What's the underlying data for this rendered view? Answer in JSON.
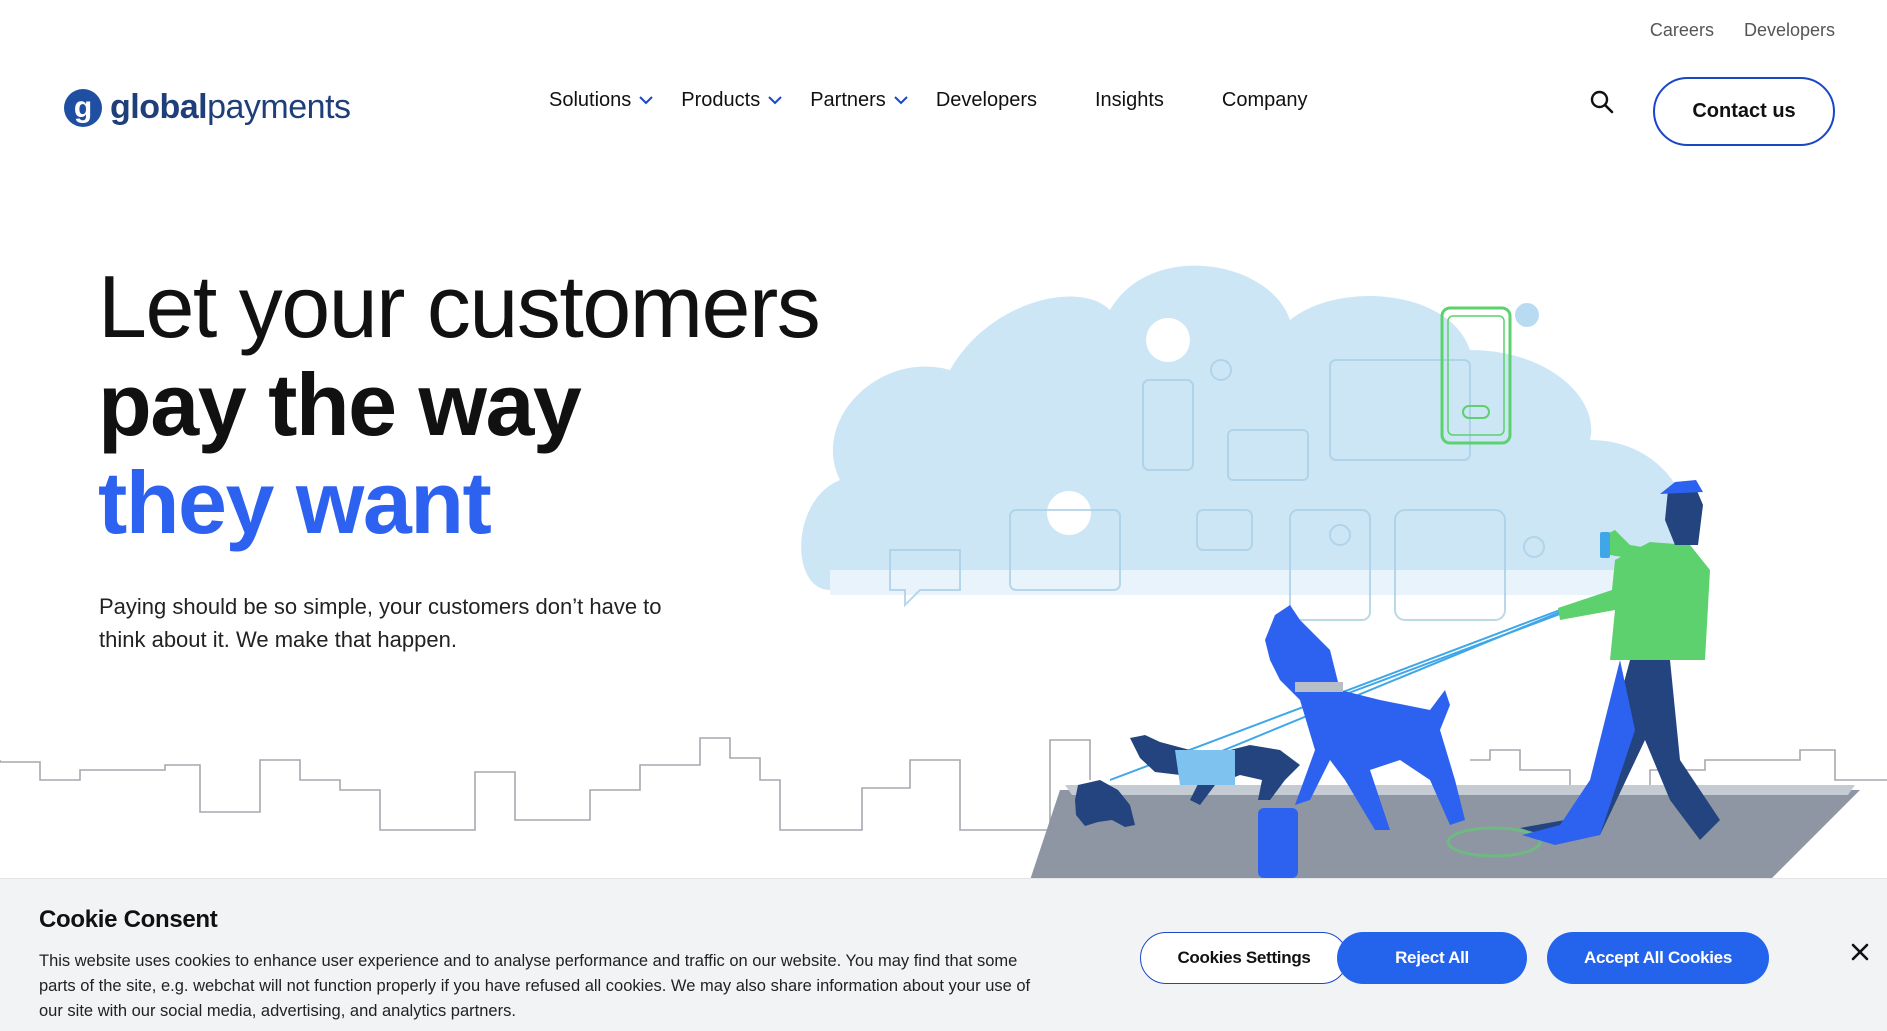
{
  "header": {
    "utility_links": [
      "Careers",
      "Developers"
    ],
    "logo": {
      "mark": "g",
      "text_bold": "global",
      "text_regular": "payments"
    },
    "nav": [
      {
        "label": "Solutions",
        "has_dropdown": true
      },
      {
        "label": "Products",
        "has_dropdown": true
      },
      {
        "label": "Partners",
        "has_dropdown": true
      },
      {
        "label": "Developers",
        "has_dropdown": false
      },
      {
        "label": "Insights",
        "has_dropdown": false
      },
      {
        "label": "Company",
        "has_dropdown": false
      }
    ],
    "search_icon": "search-icon",
    "contact_label": "Contact us"
  },
  "hero": {
    "line1": "Let your customers",
    "line2": "pay the way",
    "line3": "they want",
    "subtitle": "Paying should be so simple, your customers don’t have to think about it. We make that happen."
  },
  "cookie_banner": {
    "title": "Cookie Consent",
    "text": "This website uses cookies to enhance user experience and to analyse performance and traffic on our website. You may find that some parts of the site, e.g. webchat will not function properly if you have refused all cookies. We may also share information about your use of our site with our social media, advertising, and analytics partners.",
    "settings_label": "Cookies Settings",
    "reject_label": "Reject All",
    "accept_label": "Accept All Cookies",
    "close_icon": "close-icon"
  },
  "colors": {
    "brand_blue": "#2d62f0",
    "button_blue": "#2463eb",
    "logo_navy": "#1f3f7a",
    "cloud": "#cde6f6",
    "person_green": "#5cd16d"
  }
}
